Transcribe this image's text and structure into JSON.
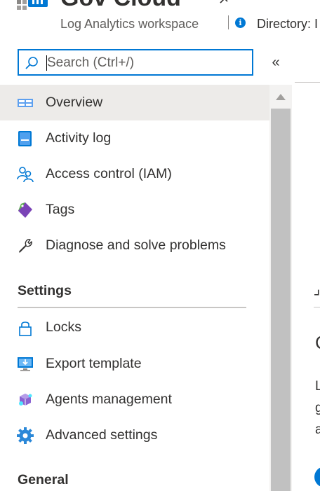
{
  "header": {
    "title": "Gov Cloud",
    "subtitle": "Log Analytics workspace",
    "directory": "Directory: I"
  },
  "search": {
    "placeholder": "Search (Ctrl+/)",
    "collapse_glyph": "«"
  },
  "menu": {
    "items": [
      {
        "label": "Overview",
        "icon": "overview-icon",
        "selected": true
      },
      {
        "label": "Activity log",
        "icon": "activity-log-icon"
      },
      {
        "label": "Access control (IAM)",
        "icon": "access-control-icon"
      },
      {
        "label": "Tags",
        "icon": "tag-icon"
      },
      {
        "label": "Diagnose and solve problems",
        "icon": "wrench-icon"
      }
    ],
    "sections": [
      {
        "title": "Settings",
        "items": [
          {
            "label": "Locks",
            "icon": "lock-icon"
          },
          {
            "label": "Export template",
            "icon": "export-template-icon"
          },
          {
            "label": "Agents management",
            "icon": "agents-icon"
          },
          {
            "label": "Advanced settings",
            "icon": "gear-icon"
          }
        ]
      },
      {
        "title": "General"
      }
    ]
  },
  "right_peek": {
    "glyph1": "C",
    "line1": "L",
    "line2": "g",
    "line3": "a"
  },
  "colors": {
    "accent": "#0078d4",
    "selected_bg": "#edebe9",
    "text": "#323130"
  }
}
